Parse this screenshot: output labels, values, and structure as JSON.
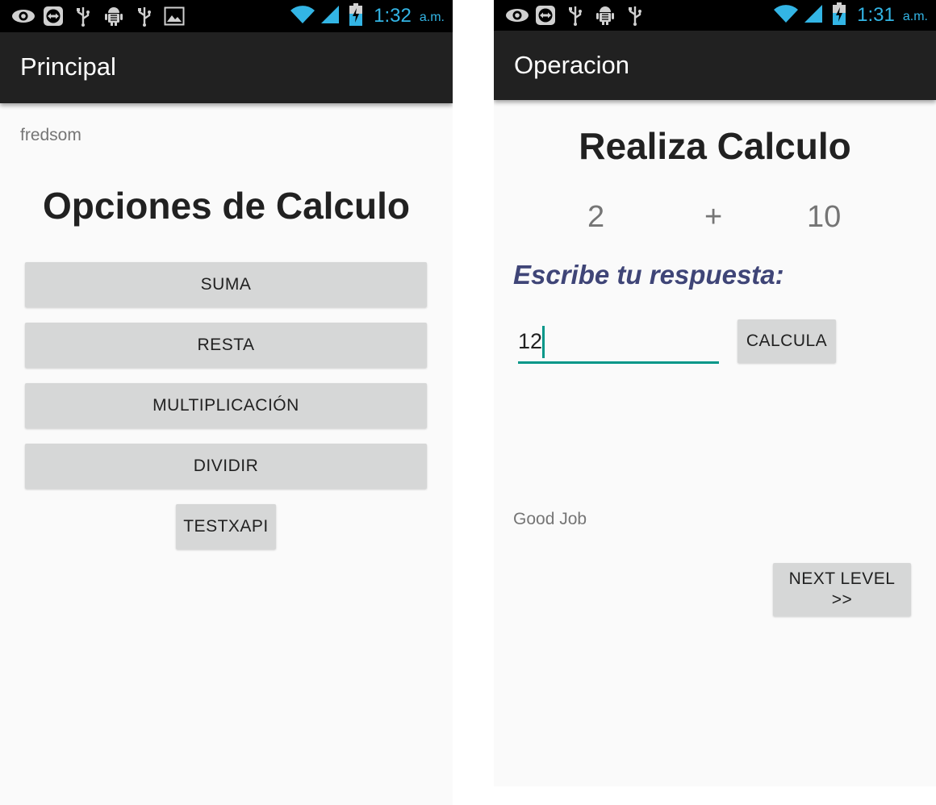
{
  "left_screen": {
    "status_bar": {
      "left_icons": [
        "eye-icon",
        "teamviewer-icon",
        "usb-icon",
        "android-debug-icon",
        "usb-icon",
        "image-icon"
      ],
      "right_icons": [
        "wifi-icon",
        "signal-icon",
        "battery-charging-icon"
      ],
      "time": "1:32",
      "ampm": "a.m."
    },
    "action_bar": {
      "title": "Principal"
    },
    "username": "fredsom",
    "heading": "Opciones de Calculo",
    "buttons": {
      "suma": "SUMA",
      "resta": "RESTA",
      "multiplicacion": "MULTIPLICACIÓN",
      "dividir": "DIVIDIR",
      "testxapi": "TESTXAPI"
    }
  },
  "right_screen": {
    "status_bar": {
      "left_icons": [
        "eye-icon",
        "teamviewer-icon",
        "usb-icon",
        "android-debug-icon",
        "usb-icon"
      ],
      "right_icons": [
        "wifi-icon",
        "signal-icon",
        "battery-charging-icon"
      ],
      "time": "1:31",
      "ampm": "a.m."
    },
    "action_bar": {
      "title": "Operacion"
    },
    "heading": "Realiza Calculo",
    "operation": {
      "operand1": "2",
      "operator": "+",
      "operand2": "10"
    },
    "prompt": "Escribe tu respuesta:",
    "answer_input": {
      "value": "12"
    },
    "calcula_button": "CALCULA",
    "result_message": "Good Job",
    "next_level_button": {
      "line1": "NEXT LEVEL",
      "line2": ">>"
    }
  },
  "colors": {
    "status_bar_bg": "#000000",
    "status_time": "#33b5e5",
    "action_bar_bg": "#212121",
    "screen_bg": "#fafafa",
    "button_bg": "#d6d7d7",
    "prompt_text": "#3f4577",
    "input_accent": "#009688"
  }
}
